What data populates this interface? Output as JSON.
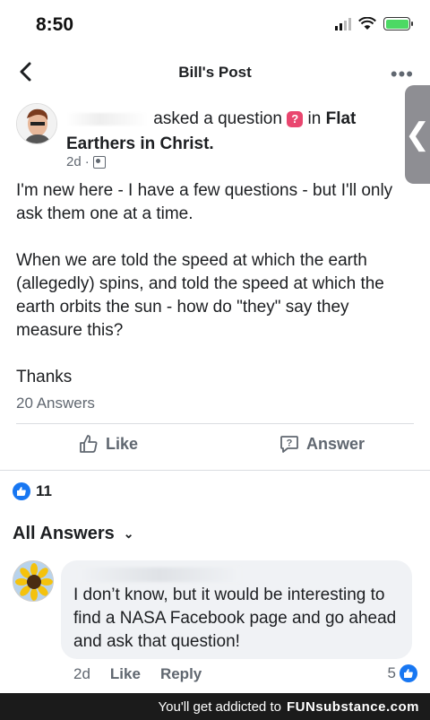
{
  "status_bar": {
    "time": "8:50",
    "icons": [
      "signal-icon",
      "wifi-icon",
      "battery-icon"
    ]
  },
  "nav": {
    "title": "Bill's Post",
    "back_icon": "chevron-left-icon",
    "more_icon": "more-dots-icon"
  },
  "side_handle": {
    "icon": "chevron-left-icon",
    "glyph": "❮"
  },
  "post": {
    "action_text": "asked a question",
    "question_icon_glyph": "?",
    "in_text": "in",
    "group_name": "Flat Earthers in Christ.",
    "time": "2d",
    "separator": "·",
    "body": [
      "I'm new here - I have a few questions - but I'll only ask them one at a time.",
      "When we are told the speed at which the earth (allegedly) spins, and told the speed at which the earth orbits the sun - how do \"they\" say they measure this?",
      "Thanks"
    ],
    "answer_count": "20 Answers"
  },
  "actions": {
    "like_label": "Like",
    "answer_label": "Answer",
    "answer_icon_glyph": "?"
  },
  "reactions": {
    "count": "11"
  },
  "answers_header": {
    "label": "All Answers",
    "chevron": "⌄"
  },
  "comment": {
    "text": "I don’t know, but it would be interesting to find a NASA Facebook page and go ahead and ask that question!",
    "time": "2d",
    "like_label": "Like",
    "reply_label": "Reply",
    "likes": "5"
  },
  "footer": {
    "prefix": "You'll get addicted to",
    "brand": "FUNsubstance.com"
  },
  "colors": {
    "accent": "#1877f2",
    "question_badge": "#e9466f",
    "footer_bg": "#1b1b1b"
  }
}
